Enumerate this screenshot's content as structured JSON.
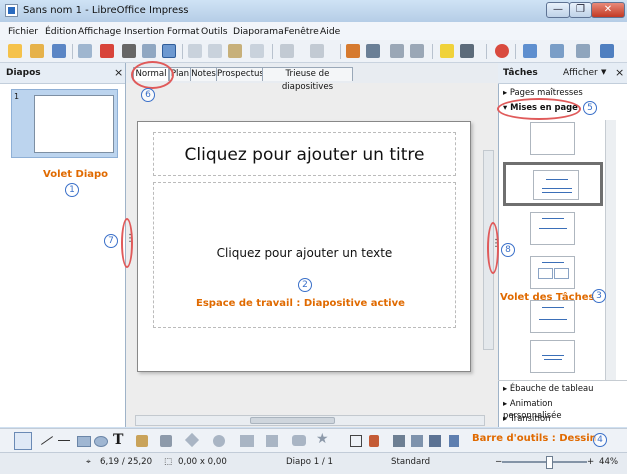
{
  "window": {
    "title": "Sans nom 1 - LibreOffice Impress",
    "min": "—",
    "max": "❐",
    "close": "✕"
  },
  "menu": [
    "Fichier",
    "Édition",
    "Affichage",
    "Insertion",
    "Format",
    "Outils",
    "Diaporama",
    "Fenêtre",
    "Aide"
  ],
  "slides_pane": {
    "title": "Diapos",
    "slide_number": "1"
  },
  "tabs": [
    "Normal",
    "Plan",
    "Notes",
    "Prospectus",
    "Trieuse de diapositives"
  ],
  "slide": {
    "title_placeholder": "Cliquez pour ajouter un titre",
    "text_placeholder": "Cliquez pour ajouter un texte"
  },
  "tasks_pane": {
    "title": "Tâches",
    "view_menu": "Afficher",
    "sections_top": [
      "Pages maîtresses",
      "Mises en page"
    ],
    "sections_bottom": [
      "Ébauche de tableau",
      "Animation personnalisée",
      "Transition"
    ]
  },
  "status": {
    "position": "6,19 / 25,20",
    "size": "0,00 x 0,00",
    "slide": "Diapo 1 / 1",
    "layout": "Standard",
    "zoom": "44%"
  },
  "annotations": {
    "volet_diapo": "Volet Diapo",
    "espace": "Espace de travail : Diapositive active",
    "volet_taches": "Volet des Tâches",
    "barre_dessin": "Barre d'outils : Dessin",
    "nums": [
      "1",
      "2",
      "3",
      "4",
      "5",
      "6",
      "7",
      "8"
    ]
  },
  "colors": {
    "annotation": "#e06a00",
    "marker_circle": "#3a70c9",
    "highlight": "#e05a5a"
  }
}
